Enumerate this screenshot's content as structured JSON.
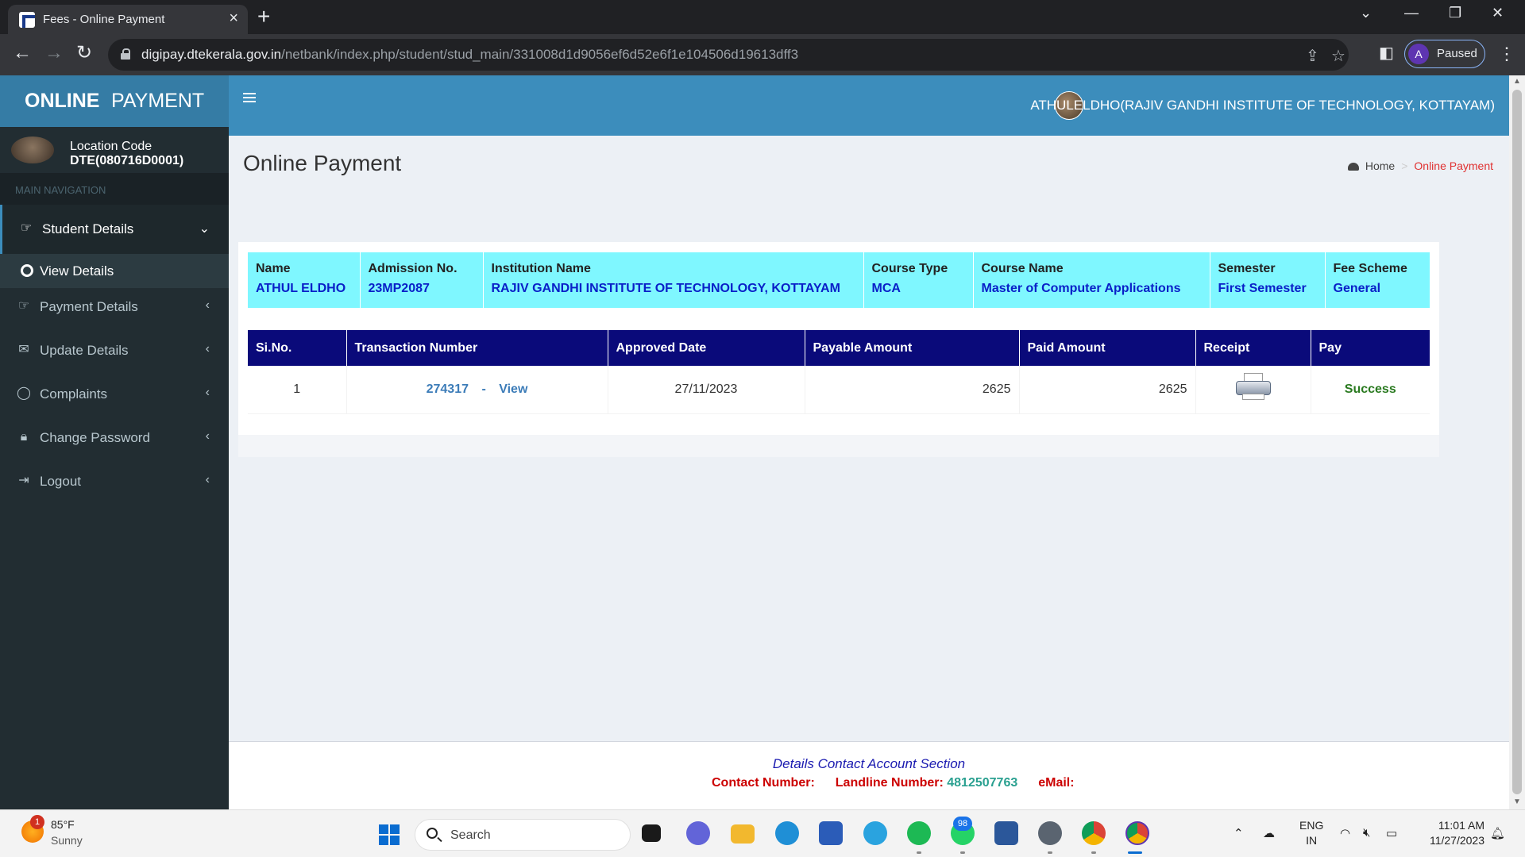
{
  "browser": {
    "tab_title": "Fees - Online Payment",
    "url_host": "digipay.dtekerala.gov.in",
    "url_path": "/netbank/index.php/student/stud_main/331008d1d9056ef6d52e6f1e104506d19613dff3",
    "profile_initial": "A",
    "profile_label": "Paused"
  },
  "header": {
    "logo_bold": "ONLINE",
    "logo_text": "PAYMENT",
    "user_name": "ATHULELDHO(RAJIV GANDHI INSTITUTE OF TECHNOLOGY, KOTTAYAM)"
  },
  "sidebar": {
    "location_label": "Location Code",
    "location_code": "DTE(080716D0001)",
    "nav_header": "MAIN NAVIGATION",
    "items": [
      {
        "label": "Student Details"
      },
      {
        "label": "View Details"
      },
      {
        "label": "Payment Details"
      },
      {
        "label": "Update Details"
      },
      {
        "label": "Complaints"
      },
      {
        "label": "Change Password"
      },
      {
        "label": "Logout"
      }
    ]
  },
  "content": {
    "title": "Online Payment",
    "breadcrumb_home": "Home",
    "breadcrumb_sep": ">",
    "breadcrumb_current": "Online Payment"
  },
  "student": {
    "headers": [
      "Name",
      "Admission No.",
      "Institution Name",
      "Course Type",
      "Course Name",
      "Semester",
      "Fee Scheme"
    ],
    "values": [
      "ATHUL ELDHO",
      "23MP2087",
      "RAJIV GANDHI INSTITUTE OF TECHNOLOGY, KOTTAYAM",
      "MCA",
      "Master of Computer Applications",
      "First Semester",
      "General"
    ]
  },
  "payments": {
    "headers": [
      "Si.No.",
      "Transaction Number",
      "Approved Date",
      "Payable Amount",
      "Paid Amount",
      "Receipt",
      "Pay"
    ],
    "rows": [
      {
        "sino": "1",
        "txn": "274317",
        "sep": "-",
        "view": "View",
        "date": "27/11/2023",
        "payable": "2625",
        "paid": "2625",
        "status": "Success"
      }
    ]
  },
  "footer": {
    "title": "Details Contact Account Section",
    "contact_label": "Contact Number:",
    "landline_label": "Landline Number:",
    "landline_number": "4812507763",
    "email_label": "eMail:"
  },
  "taskbar": {
    "weather_badge": "1",
    "weather_temp": "85°F",
    "weather_desc": "Sunny",
    "search_label": "Search",
    "whatsapp_badge": "98",
    "lang_top": "ENG",
    "lang_bottom": "IN",
    "time": "11:01 AM",
    "date": "11/27/2023"
  }
}
